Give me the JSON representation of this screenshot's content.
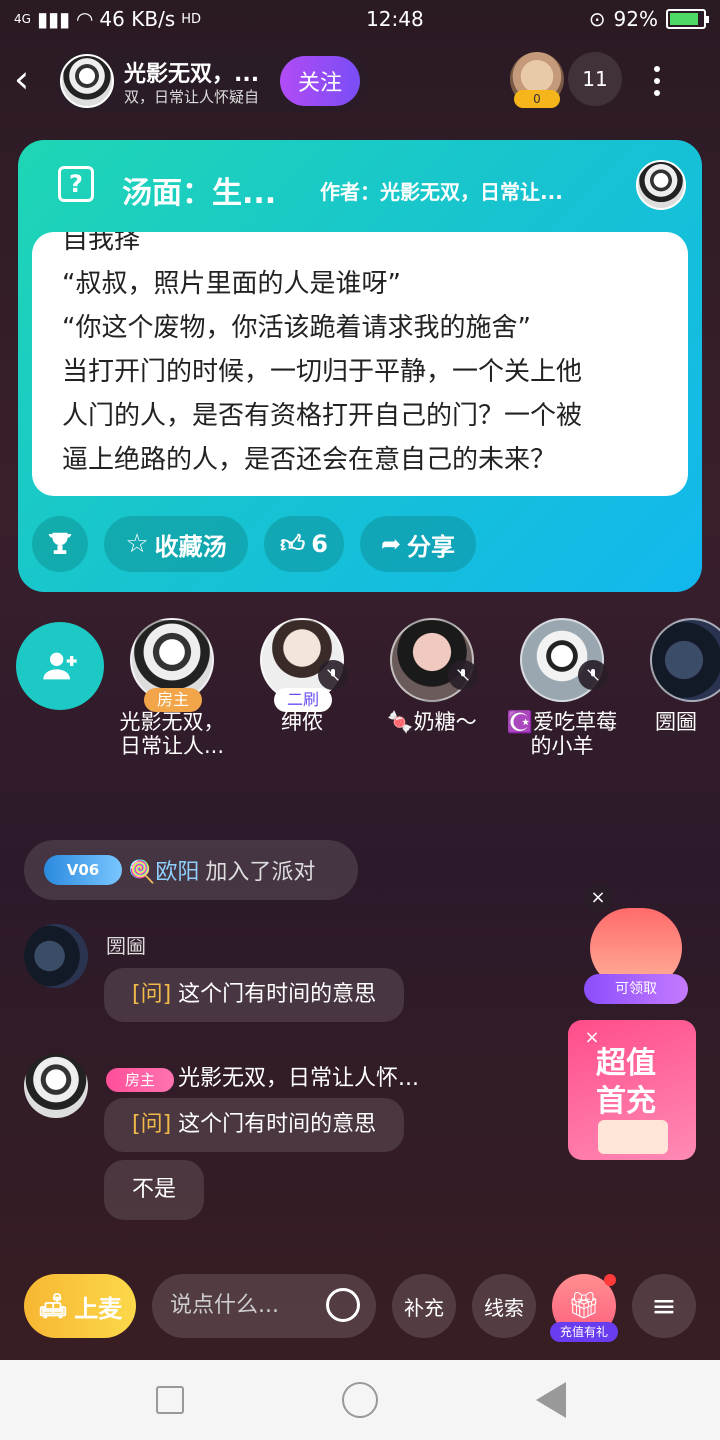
{
  "status_bar": {
    "network": "4G",
    "speed": "46 KB/s",
    "hd": "HD",
    "time": "12:48",
    "battery": "92%"
  },
  "room": {
    "title": "光影无双，...",
    "subtitle": "双，日常让人怀疑自",
    "follow_label": "关注",
    "viewer_badge": "0",
    "viewer_count": "11"
  },
  "soup_card": {
    "title": "汤面：生...",
    "author": "作者：光影无双，日常让...",
    "story_lines": [
      "自我择",
      "“叔叔，照片里面的人是谁呀”",
      "“你这个废物，你活该跪着请求我的施舍”",
      "当打开门的时候，一切归于平静，一个关上他",
      "人门的人，是否有资格打开自己的门？一个被",
      "逼上绝路的人，是否还会在意自己的未来？"
    ],
    "actions": {
      "favorite_label": "收藏汤",
      "like_count": "6",
      "share_label": "分享"
    }
  },
  "seats": [
    {
      "name": "光影无双，日常让人...",
      "tag": "房主"
    },
    {
      "name": "绅侬",
      "tag": "二刷"
    },
    {
      "name": "🍬奶糖～",
      "tag": ""
    },
    {
      "name": "☪️爱吃草莓的小羊",
      "tag": ""
    },
    {
      "name": "圐圙",
      "tag": ""
    }
  ],
  "chat": {
    "join": {
      "level": "V06",
      "user": "🍭欧阳",
      "text": "加入了派对"
    },
    "messages": [
      {
        "name": "圐圙",
        "q_tag": "[问]",
        "text": "这个门有时间的意思"
      },
      {
        "name": "光影无双，日常让人怀...",
        "badge": "房主",
        "q_tag": "[问]",
        "text": "这个门有时间的意思",
        "reply": "不是"
      }
    ]
  },
  "floats": {
    "gift_label": "可领取",
    "recharge_line1": "超值",
    "recharge_line2": "首充"
  },
  "bottom_bar": {
    "mic_label": "上麦",
    "input_placeholder": "说点什么...",
    "supplement_label": "补充",
    "clue_label": "线索",
    "recharge_gift_label": "充值有礼"
  },
  "colors": {
    "card_start": "#1fd6b4",
    "card_end": "#12b8ee",
    "follow": "#9a4df5",
    "mic": "#f7b733",
    "owner_badge": "#ff4f9a",
    "q_tag": "#f0b94a"
  }
}
